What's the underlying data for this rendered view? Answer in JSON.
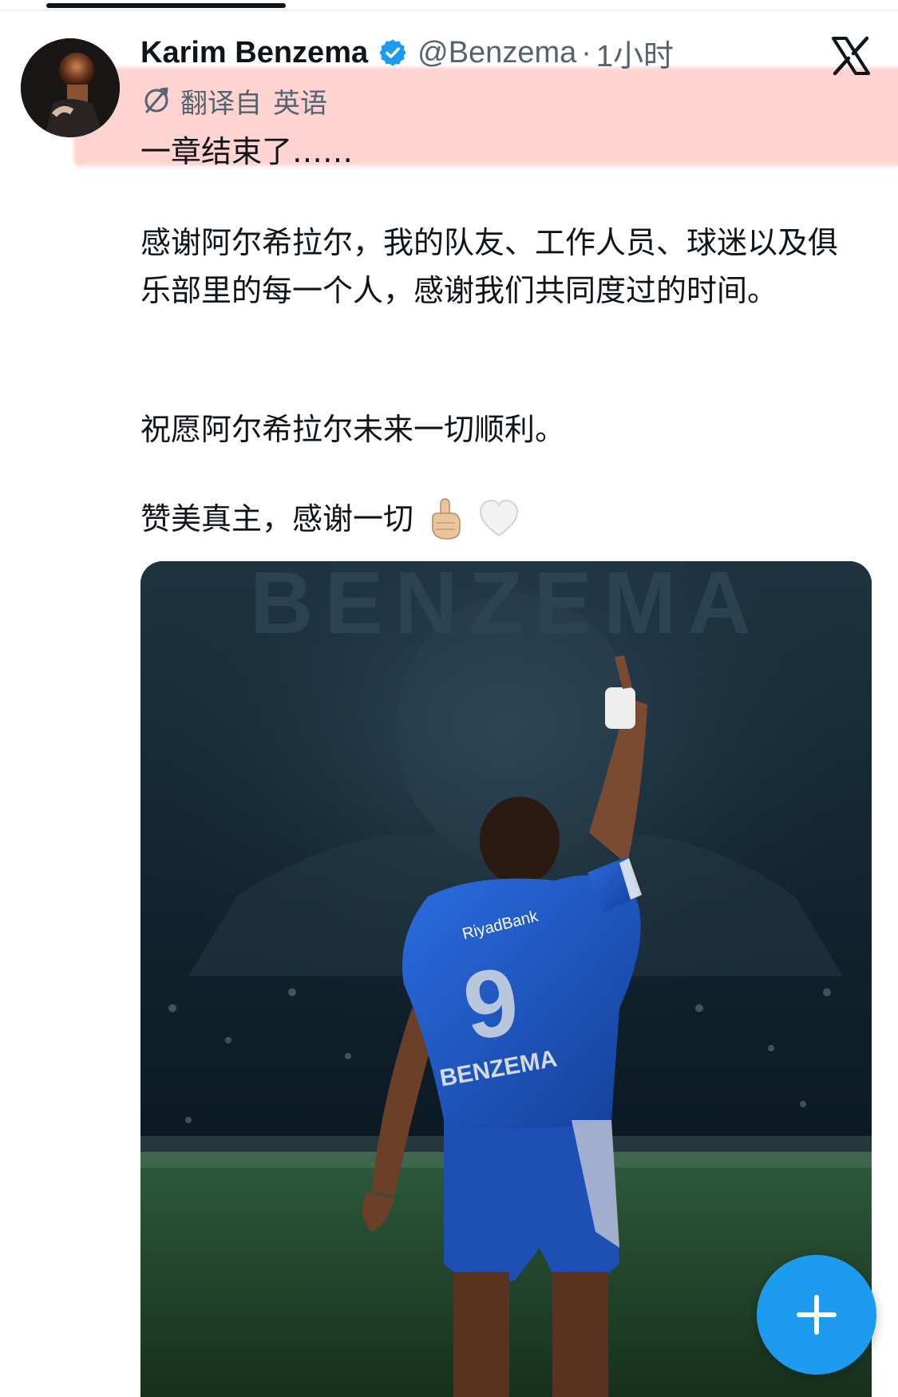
{
  "header": {
    "display_name": "Karim Benzema",
    "handle": "@Benzema",
    "separator": "·",
    "time": "1小时"
  },
  "translation": {
    "label": "翻译自",
    "language": "英语"
  },
  "tweet": {
    "line1": "一章结束了……",
    "para1": "感谢阿尔希拉尔，我的队友、工作人员、球迷以及俱乐部里的每一个人，感谢我们共同度过的时间。",
    "para2": "祝愿阿尔希拉尔未来一切顺利。",
    "para3": "赞美真主，感谢一切"
  },
  "media": {
    "jersey_sponsor": "RiyadBank",
    "jersey_number": "9",
    "jersey_name": "BENZEMA",
    "banner_text": "BENZEMA"
  },
  "icons": {
    "verified": "verified-badge-icon",
    "x_logo": "x-logo-icon",
    "translate": "translate-icon",
    "compose": "plus-icon"
  },
  "colors": {
    "accent": "#1d9bf0",
    "highlight": "#ffb0aa",
    "jersey": "#1f5fd0"
  }
}
